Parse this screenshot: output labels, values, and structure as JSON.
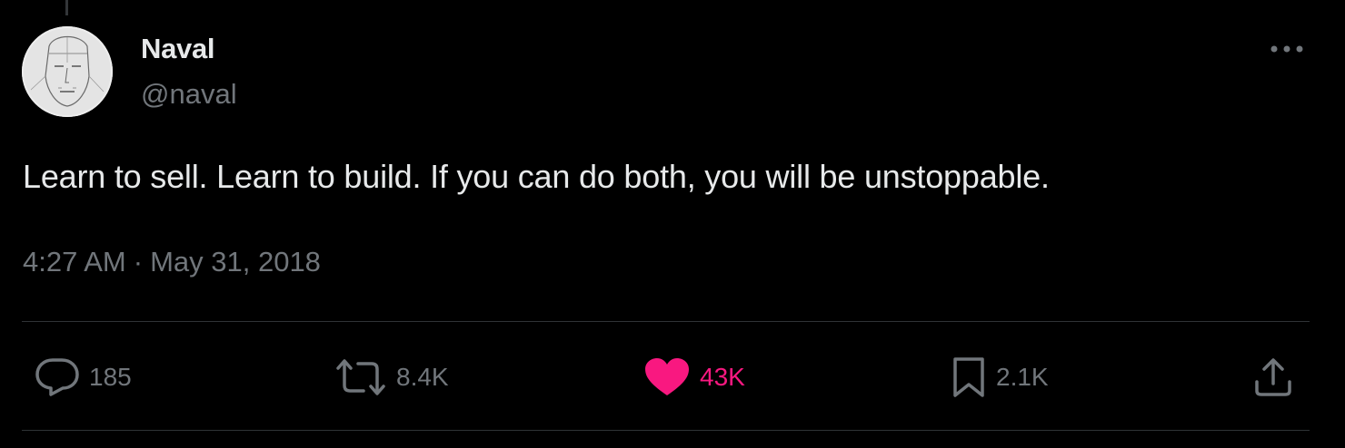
{
  "tweet": {
    "author": {
      "display_name": "Naval",
      "handle": "@naval"
    },
    "text": "Learn to sell. Learn to build. If you can do both, you will be unstoppable.",
    "time": "4:27 AM",
    "separator": "·",
    "date": "May 31, 2018"
  },
  "actions": {
    "reply": {
      "icon": "reply-icon",
      "count": "185"
    },
    "repost": {
      "icon": "repost-icon",
      "count": "8.4K"
    },
    "like": {
      "icon": "heart-icon",
      "count": "43K",
      "liked": true
    },
    "bookmark": {
      "icon": "bookmark-icon",
      "count": "2.1K"
    },
    "share": {
      "icon": "share-icon"
    }
  },
  "more_menu": {
    "icon": "more-horizontal-icon"
  },
  "colors": {
    "background": "#000000",
    "primary_text": "#e7e9ea",
    "secondary_text": "#71767b",
    "like_pink": "#f91880",
    "divider": "#2f3336"
  }
}
